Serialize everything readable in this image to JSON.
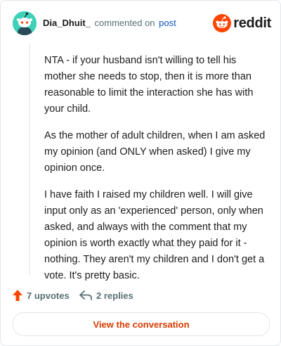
{
  "header": {
    "username": "Dia_Dhuit_",
    "verb": "commented on",
    "link_text": "post",
    "brand": "reddit"
  },
  "comment": {
    "paragraphs": [
      "NTA - if your husband isn't willing to tell his mother she needs to stop, then it is more than reasonable to limit the interaction she has with your child.",
      "As the mother of adult children, when I am asked my opinion (and ONLY when asked) I give my opinion once.",
      "I have faith I raised my children well. I will give input only as an 'experienced' person, only when asked, and always with the comment that my opinion is worth exactly what they paid for it - nothing. They aren't my children and I don't get a vote. It's pretty basic."
    ]
  },
  "footer": {
    "upvotes_label": "7 upvotes",
    "replies_label": "2 replies"
  },
  "cta": {
    "label": "View the conversation"
  },
  "icons": {
    "avatar": "snoo-avatar-icon",
    "logo": "reddit-logo-icon",
    "upvote": "upvote-arrow-icon",
    "reply": "reply-arrow-icon"
  },
  "colors": {
    "accent": "#ff4500",
    "cta_text": "#d93a00",
    "link": "#0a53cf",
    "avatar_bg": "#3dd1b8"
  }
}
